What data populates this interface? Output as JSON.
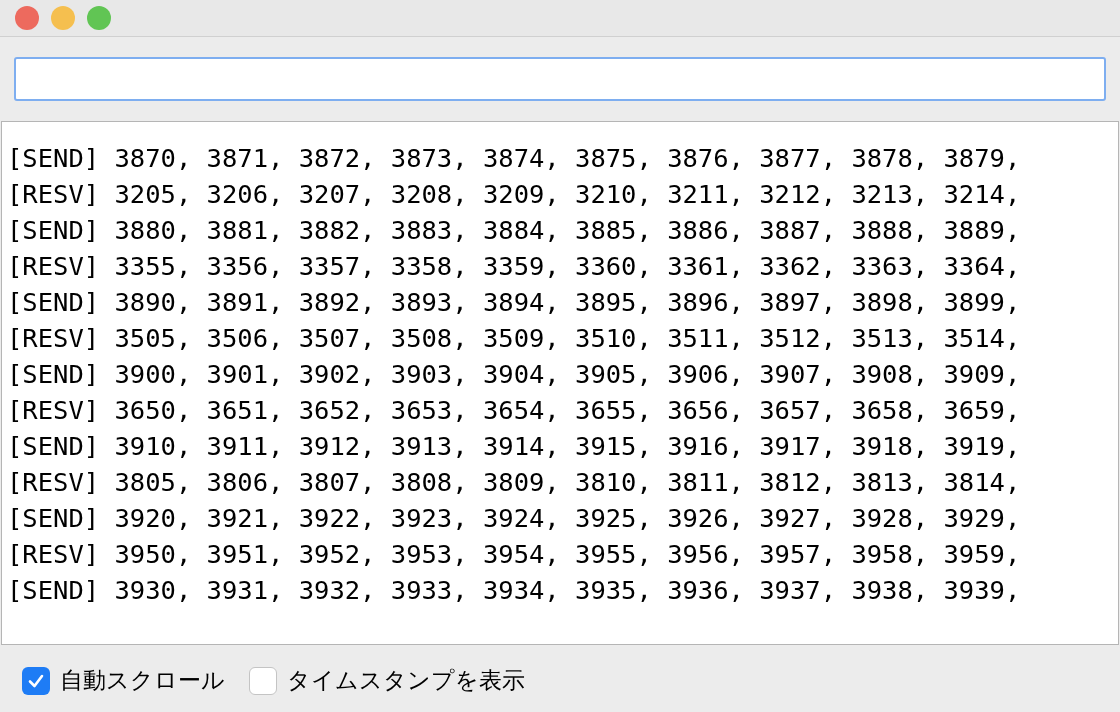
{
  "output_lines": [
    "[SEND] 3870, 3871, 3872, 3873, 3874, 3875, 3876, 3877, 3878, 3879,",
    "[RESV] 3205, 3206, 3207, 3208, 3209, 3210, 3211, 3212, 3213, 3214,",
    "[SEND] 3880, 3881, 3882, 3883, 3884, 3885, 3886, 3887, 3888, 3889,",
    "[RESV] 3355, 3356, 3357, 3358, 3359, 3360, 3361, 3362, 3363, 3364,",
    "[SEND] 3890, 3891, 3892, 3893, 3894, 3895, 3896, 3897, 3898, 3899,",
    "[RESV] 3505, 3506, 3507, 3508, 3509, 3510, 3511, 3512, 3513, 3514,",
    "[SEND] 3900, 3901, 3902, 3903, 3904, 3905, 3906, 3907, 3908, 3909,",
    "[RESV] 3650, 3651, 3652, 3653, 3654, 3655, 3656, 3657, 3658, 3659,",
    "[SEND] 3910, 3911, 3912, 3913, 3914, 3915, 3916, 3917, 3918, 3919,",
    "[RESV] 3805, 3806, 3807, 3808, 3809, 3810, 3811, 3812, 3813, 3814,",
    "[SEND] 3920, 3921, 3922, 3923, 3924, 3925, 3926, 3927, 3928, 3929,",
    "[RESV] 3950, 3951, 3952, 3953, 3954, 3955, 3956, 3957, 3958, 3959,",
    "[SEND] 3930, 3931, 3932, 3933, 3934, 3935, 3936, 3937, 3938, 3939,"
  ],
  "options": [
    {
      "label": "自動スクロール",
      "checked": true
    },
    {
      "label": "タイムスタンプを表示",
      "checked": false
    }
  ]
}
